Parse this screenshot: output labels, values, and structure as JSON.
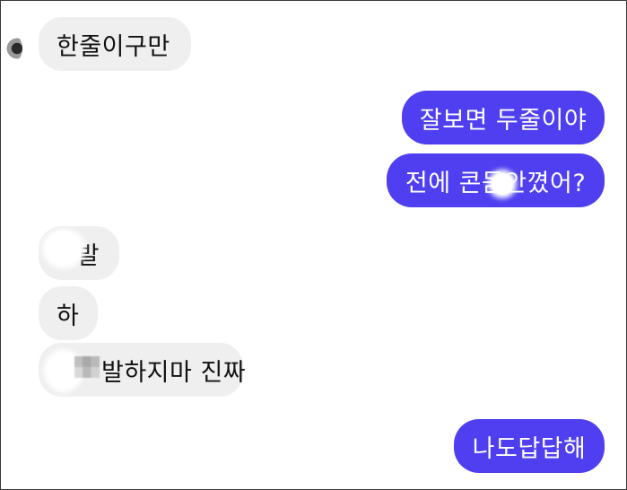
{
  "messages": {
    "m1": "한줄이구만",
    "m2": "잘보면 두줄이야",
    "m3": "전에 콘돔안꼈어?",
    "m4": "발",
    "m5": "하",
    "m6": "발하지마 진짜",
    "m7": "나도답답해"
  },
  "colors": {
    "outgoing_bubble": "#4f3ff0",
    "incoming_bubble": "#efefef"
  }
}
